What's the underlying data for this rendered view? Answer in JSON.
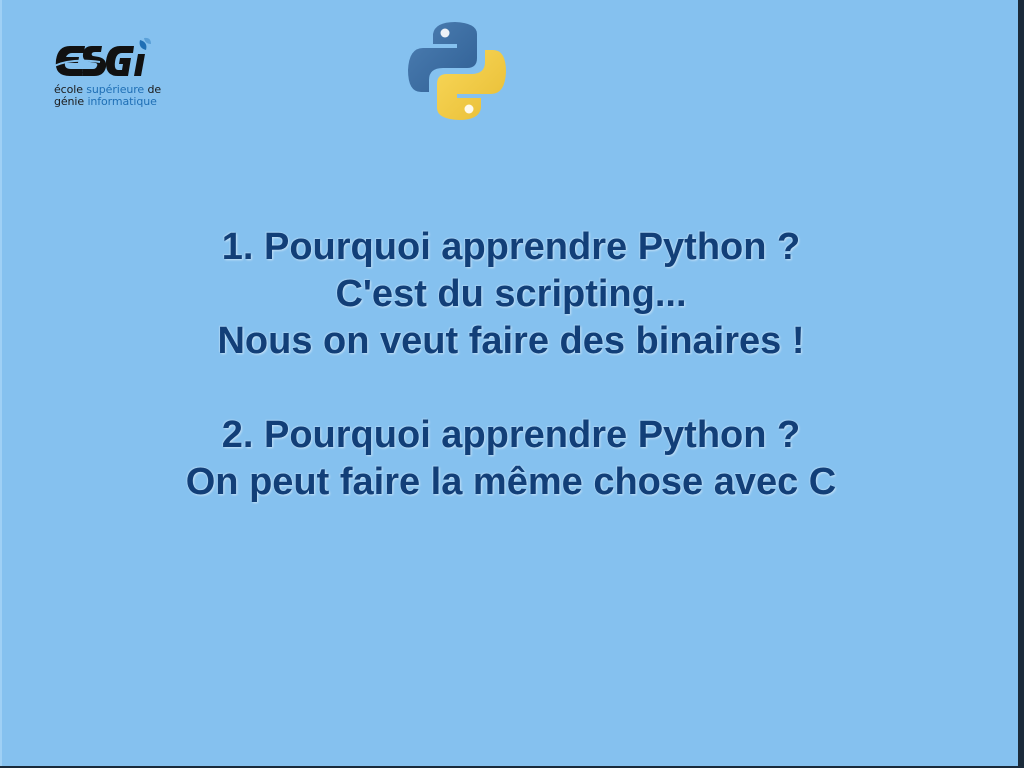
{
  "logo": {
    "brand": "ESGi",
    "subtitle": {
      "line1_dark": "école ",
      "line1_blue": "supérieure",
      "line1_dark2": " de",
      "line2_dark": "génie ",
      "line2_blue": "informatique"
    },
    "accent_blue": "#1f6fb5"
  },
  "python_logo": {
    "icon": "python-icon",
    "colors": {
      "blue": "#3a6ea5",
      "yellow": "#f7cf4a"
    }
  },
  "slide": {
    "background": "#85c1ef",
    "text_color": "#123f78",
    "block1": [
      "1. Pourquoi apprendre Python ?",
      "C'est du scripting...",
      "Nous on veut faire des binaires !"
    ],
    "block2": [
      "2. Pourquoi apprendre Python ?",
      "On peut faire la même chose avec C"
    ]
  }
}
